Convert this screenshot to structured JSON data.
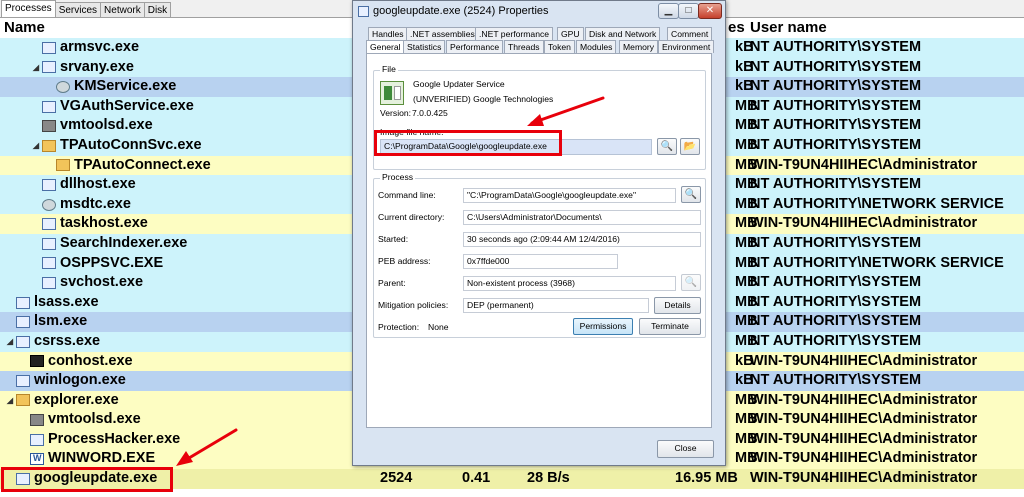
{
  "main": {
    "tabs": [
      {
        "label": "Processes"
      },
      {
        "label": "Services"
      },
      {
        "label": "Network"
      },
      {
        "label": "Disk"
      }
    ],
    "columns": {
      "name": "Name",
      "bytes_frag": "es",
      "user": "User name"
    },
    "rows": [
      {
        "name": "armsvc.exe",
        "mem": "kB",
        "user": "NT AUTHORITY\\SYSTEM"
      },
      {
        "name": "srvany.exe",
        "mem": "kB",
        "user": "NT AUTHORITY\\SYSTEM"
      },
      {
        "name": "KMService.exe",
        "mem": "kB",
        "user": "NT AUTHORITY\\SYSTEM"
      },
      {
        "name": "VGAuthService.exe",
        "mem": "MB",
        "user": "NT AUTHORITY\\SYSTEM"
      },
      {
        "name": "vmtoolsd.exe",
        "mem": "MB",
        "user": "NT AUTHORITY\\SYSTEM"
      },
      {
        "name": "TPAutoConnSvc.exe",
        "mem": "MB",
        "user": "NT AUTHORITY\\SYSTEM"
      },
      {
        "name": "TPAutoConnect.exe",
        "mem": "MB",
        "user": "WIN-T9UN4HIIHEC\\Administrator"
      },
      {
        "name": "dllhost.exe",
        "mem": "MB",
        "user": "NT AUTHORITY\\SYSTEM"
      },
      {
        "name": "msdtc.exe",
        "mem": "MB",
        "user": "NT AUTHORITY\\NETWORK SERVICE"
      },
      {
        "name": "taskhost.exe",
        "mem": "MB",
        "user": "WIN-T9UN4HIIHEC\\Administrator"
      },
      {
        "name": "SearchIndexer.exe",
        "mem": "MB",
        "user": "NT AUTHORITY\\SYSTEM"
      },
      {
        "name": "OSPPSVC.EXE",
        "mem": "MB",
        "user": "NT AUTHORITY\\NETWORK SERVICE"
      },
      {
        "name": "svchost.exe",
        "mem": "MB",
        "user": "NT AUTHORITY\\SYSTEM"
      },
      {
        "name": "lsass.exe",
        "mem": "MB",
        "user": "NT AUTHORITY\\SYSTEM"
      },
      {
        "name": "lsm.exe",
        "mem": "MB",
        "user": "NT AUTHORITY\\SYSTEM"
      },
      {
        "name": "csrss.exe",
        "mem": "MB",
        "user": "NT AUTHORITY\\SYSTEM"
      },
      {
        "name": "conhost.exe",
        "mem": "kB",
        "user": "WIN-T9UN4HIIHEC\\Administrator"
      },
      {
        "name": "winlogon.exe",
        "mem": "kB",
        "user": "NT AUTHORITY\\SYSTEM"
      },
      {
        "name": "explorer.exe",
        "mem": "MB",
        "user": "WIN-T9UN4HIIHEC\\Administrator"
      },
      {
        "name": "vmtoolsd.exe",
        "mem": "MB",
        "user": "WIN-T9UN4HIIHEC\\Administrator"
      },
      {
        "name": "ProcessHacker.exe",
        "mem": "MB",
        "user": "WIN-T9UN4HIIHEC\\Administrator"
      },
      {
        "name": "WINWORD.EXE",
        "mem": "MB",
        "user": "WIN-T9UN4HIIHEC\\Administrator"
      },
      {
        "name": "googleupdate.exe",
        "pid": "2524",
        "cpu": "0.41",
        "io": "28 B/s",
        "private_bytes": "16.95 MB",
        "user": "WIN-T9UN4HIIHEC\\Administrator"
      }
    ]
  },
  "dialog": {
    "title": "googleupdate.exe (2524) Properties",
    "tabs_row1": [
      "Handles",
      ".NET assemblies",
      ".NET performance",
      "GPU",
      "Disk and Network",
      "Comment"
    ],
    "tabs_row2": [
      "General",
      "Statistics",
      "Performance",
      "Threads",
      "Token",
      "Modules",
      "Memory",
      "Environment"
    ],
    "file": {
      "group_title": "File",
      "description": "Google Updater Service",
      "company": "(UNVERIFIED) Google Technologies",
      "version_label": "Version:",
      "version": "7.0.0.425",
      "image_label": "Image file name:",
      "image_path": "C:\\ProgramData\\Google\\googleupdate.exe"
    },
    "process": {
      "group_title": "Process",
      "cmdline_label": "Command line:",
      "cmdline": "\"C:\\ProgramData\\Google\\googleupdate.exe\"",
      "curdir_label": "Current directory:",
      "curdir": "C:\\Users\\Administrator\\Documents\\",
      "started_label": "Started:",
      "started": "30 seconds ago (2:09:44 AM 12/4/2016)",
      "peb_label": "PEB address:",
      "peb": "0x7ffde000",
      "parent_label": "Parent:",
      "parent": "Non-existent process (3968)",
      "mitigation_label": "Mitigation policies:",
      "mitigation": "DEP (permanent)",
      "details_button": "Details",
      "protection_label": "Protection:",
      "protection": "None",
      "permissions_button": "Permissions",
      "terminate_button": "Terminate"
    },
    "close_button": "Close"
  },
  "colors": {
    "row_cyan": "#cdf3fb",
    "row_blue": "#b8d2f0",
    "row_yellow": "#fdfdc2",
    "annotation_red": "#e8000b",
    "path_highlight": "#d9e4f7"
  }
}
